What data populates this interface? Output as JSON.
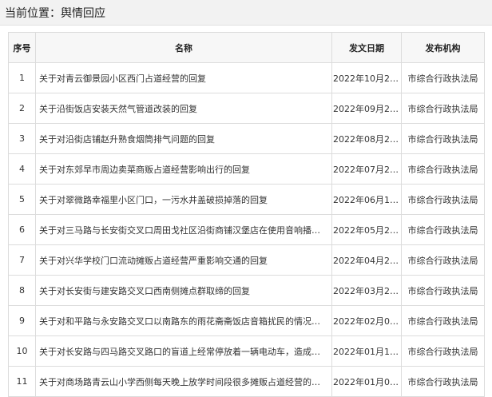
{
  "breadcrumb": {
    "label": "当前位置：",
    "current": "舆情回应"
  },
  "table": {
    "headers": [
      "序号",
      "名称",
      "发文日期",
      "发布机构"
    ],
    "rows": [
      {
        "index": "1",
        "title": "关于对青云御景园小区西门占道经营的回复",
        "date": "2022年10月27日",
        "org": "市综合行政执法局"
      },
      {
        "index": "2",
        "title": "关于沿街饭店安装天然气管道改装的回复",
        "date": "2022年09月22日",
        "org": "市综合行政执法局"
      },
      {
        "index": "3",
        "title": "关于对沿街店铺赵升熟食烟筒排气问题的回复",
        "date": "2022年08月22日",
        "org": "市综合行政执法局"
      },
      {
        "index": "4",
        "title": "关于对东郊早市周边卖菜商贩占道经营影响出行的回复",
        "date": "2022年07月20日",
        "org": "市综合行政执法局"
      },
      {
        "index": "5",
        "title": "关于对翠微路幸福里小区门口，一污水井盖破损掉落的回复",
        "date": "2022年06月14日",
        "org": "市综合行政执法局"
      },
      {
        "index": "6",
        "title": "关于对三马路与长安街交叉口周田戈社区沿街商铺汉堡店在使用音响播放音乐噪声扰民的回复",
        "date": "2022年05月27日",
        "org": "市综合行政执法局"
      },
      {
        "index": "7",
        "title": "关于对兴华学校门口流动摊贩占道经营严重影响交通的回复",
        "date": "2022年04月29日",
        "org": "市综合行政执法局"
      },
      {
        "index": "8",
        "title": "关于对长安街与建安路交叉口西南侧摊点群取缔的回复",
        "date": "2022年03月22日",
        "org": "市综合行政执法局"
      },
      {
        "index": "9",
        "title": "关于对和平路与永安路交叉口以南路东的雨花斋斋饭店音箱扰民的情况回复",
        "date": "2022年02月05日",
        "org": "市综合行政执法局"
      },
      {
        "index": "10",
        "title": "关于对长安路与四马路交叉路口的盲道上经常停放着一辆电动车，造成不便的情况回复",
        "date": "2022年01月12日",
        "org": "市综合行政执法局"
      },
      {
        "index": "11",
        "title": "关于对商场路青云山小学西侧每天晚上放学时间段很多摊贩占道经营的情况回复",
        "date": "2022年01月04日",
        "org": "市综合行政执法局"
      }
    ]
  }
}
